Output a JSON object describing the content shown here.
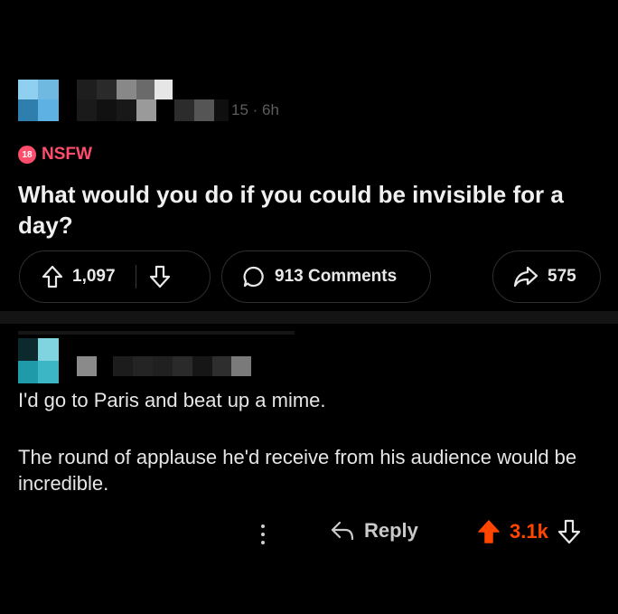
{
  "post": {
    "meta": "15 · 6h",
    "nsfw_badge": "18",
    "nsfw_label": "NSFW",
    "title": "What would you do if you could be invisible for a day?",
    "upvotes": "1,097",
    "comments_label": "913 Comments",
    "shares": "575"
  },
  "comment": {
    "line1": "I'd go to Paris and beat up a mime.",
    "line2": "The round of applause he'd receive from his audience would be incredible.",
    "reply_label": "Reply",
    "score": "3.1k"
  },
  "colors": {
    "background": "#000000",
    "nsfw": "#ff4d6b",
    "upvote_active": "#ff4500"
  },
  "icons": [
    "upvote-icon",
    "downvote-icon",
    "comment-bubble-icon",
    "share-arrow-icon",
    "more-options-icon",
    "reply-arrow-icon"
  ]
}
